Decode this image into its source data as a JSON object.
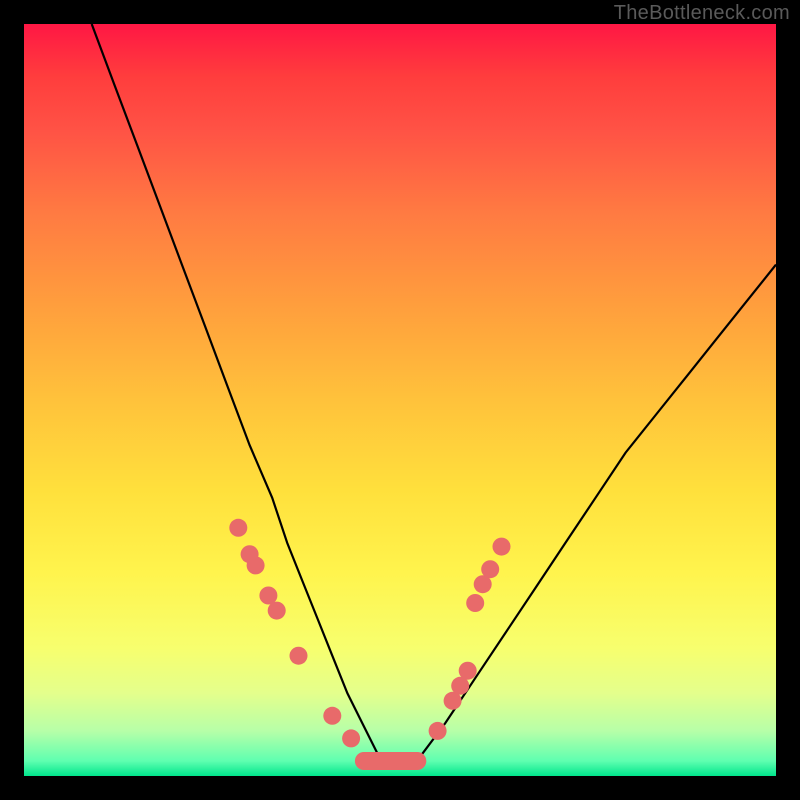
{
  "watermark": "TheBottleneck.com",
  "chart_data": {
    "type": "line",
    "title": "",
    "xlabel": "",
    "ylabel": "",
    "xlim": [
      0,
      100
    ],
    "ylim": [
      0,
      100
    ],
    "grid": false,
    "series": [
      {
        "name": "curve",
        "style": "line",
        "color": "#000000",
        "x": [
          9,
          12,
          15,
          18,
          21,
          24,
          27,
          30,
          33,
          35,
          37,
          39,
          41,
          43,
          45,
          47,
          49,
          51,
          53,
          56,
          60,
          64,
          68,
          72,
          76,
          80,
          84,
          88,
          92,
          96,
          100
        ],
        "y": [
          100,
          92,
          84,
          76,
          68,
          60,
          52,
          44,
          37,
          31,
          26,
          21,
          16,
          11,
          7,
          3,
          1,
          1,
          3,
          7,
          13,
          19,
          25,
          31,
          37,
          43,
          48,
          53,
          58,
          63,
          68
        ]
      },
      {
        "name": "left-dots",
        "style": "scatter",
        "color": "#e86a6a",
        "x": [
          28.5,
          30.0,
          30.8,
          32.5,
          33.6,
          36.5,
          41.0,
          43.5
        ],
        "y": [
          33.0,
          29.5,
          28.0,
          24.0,
          22.0,
          16.0,
          8.0,
          5.0
        ]
      },
      {
        "name": "right-dots",
        "style": "scatter",
        "color": "#e86a6a",
        "x": [
          55.0,
          57.0,
          58.0,
          59.0,
          60.0,
          61.0,
          62.0,
          63.5
        ],
        "y": [
          6.0,
          10.0,
          12.0,
          14.0,
          23.0,
          25.5,
          27.5,
          30.5
        ]
      },
      {
        "name": "bottom-bar",
        "style": "bar-segment",
        "color": "#e86a6a",
        "x_start": 44.0,
        "x_end": 53.5,
        "y": 2.0
      }
    ]
  }
}
